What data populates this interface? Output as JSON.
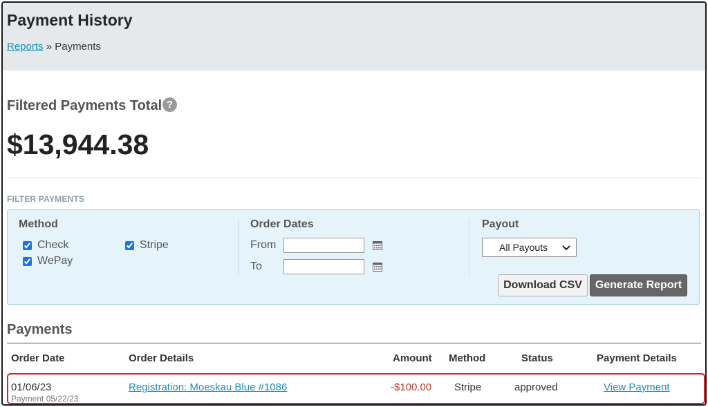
{
  "header": {
    "title": "Payment History",
    "breadcrumb": {
      "parent": "Reports",
      "separator": "»",
      "current": "Payments"
    }
  },
  "summary": {
    "label": "Filtered Payments Total",
    "help_icon": "question-circle-icon",
    "value": "$13,944.38"
  },
  "filters": {
    "heading": "FILTER PAYMENTS",
    "method": {
      "title": "Method",
      "options": [
        {
          "label": "Check",
          "checked": true
        },
        {
          "label": "Stripe",
          "checked": true
        },
        {
          "label": "WePay",
          "checked": true
        }
      ]
    },
    "order_dates": {
      "title": "Order Dates",
      "from_label": "From",
      "to_label": "To",
      "from_value": "",
      "to_value": "",
      "calendar_icon": "calendar-icon"
    },
    "payout": {
      "title": "Payout",
      "selected": "All Payouts"
    },
    "buttons": {
      "download_csv": "Download CSV",
      "generate_report": "Generate Report"
    }
  },
  "payments": {
    "title": "Payments",
    "columns": [
      "Order Date",
      "Order Details",
      "Amount",
      "Method",
      "Status",
      "Payment Details"
    ],
    "rows": [
      {
        "order_date": "01/06/23",
        "payment_date": "Payment 05/22/23",
        "order_details": "Registration: Moeskau Blue #1086",
        "amount": "-$100.00",
        "method": "Stripe",
        "status": "approved",
        "payment_details": "View Payment"
      }
    ]
  },
  "colors": {
    "header_bg": "#e6e9ec",
    "link": "#1a8fb8",
    "filter_panel_bg": "#e5f4fb",
    "negative_amount": "#c0392b",
    "highlight_border": "#d62828"
  }
}
